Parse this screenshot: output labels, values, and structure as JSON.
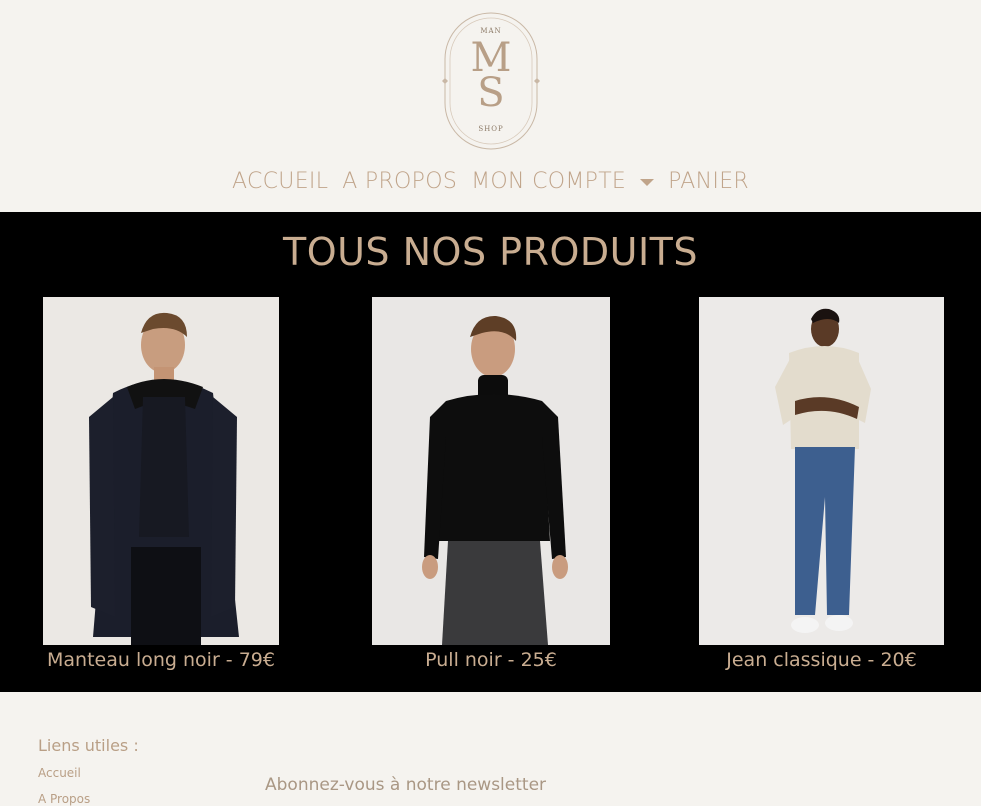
{
  "logo": {
    "top_text": "MAN",
    "letter_m": "M",
    "letter_s": "S",
    "bottom_text": "SHOP"
  },
  "nav": {
    "items": [
      "ACCUEIL",
      "A PROPOS",
      "MON COMPTE",
      "PANIER"
    ],
    "dropdown_icon": "caret-down-icon"
  },
  "products": {
    "heading": "TOUS NOS PRODUITS",
    "items": [
      {
        "caption": "Manteau long noir - 79€"
      },
      {
        "caption": "Pull noir - 25€"
      },
      {
        "caption": "Jean classique - 20€"
      }
    ]
  },
  "footer": {
    "links_title": "Liens utiles :",
    "links": [
      "Accueil",
      "A Propos"
    ],
    "newsletter_label": "Abonnez-vous à notre newsletter"
  },
  "colors": {
    "background": "#f5f3ef",
    "accent": "#c0a48a",
    "products_band": "#000000"
  }
}
